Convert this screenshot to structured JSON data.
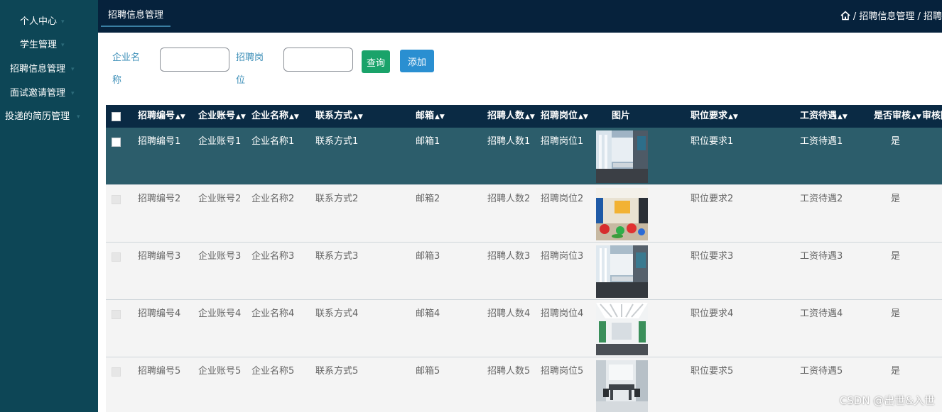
{
  "sidebar": {
    "items": [
      {
        "label": "个人中心"
      },
      {
        "label": "学生管理"
      },
      {
        "label": "招聘信息管理"
      },
      {
        "label": "面试邀请管理"
      },
      {
        "label": "投递的简历管理"
      }
    ]
  },
  "topbar": {
    "tab_label": "招聘信息管理",
    "breadcrumb": "/ 招聘信息管理 / 招聘"
  },
  "search": {
    "company_label": "企业名称",
    "company_value": "",
    "position_label": "招聘岗位",
    "position_value": "",
    "query_label": "查询",
    "add_label": "添加"
  },
  "table": {
    "columns": [
      "招聘编号",
      "企业账号",
      "企业名称",
      "联系方式",
      "邮箱",
      "招聘人数",
      "招聘岗位",
      "图片",
      "职位要求",
      "工资待遇",
      "是否审核",
      "审核回"
    ],
    "rows": [
      {
        "no": "招聘编号1",
        "account": "企业账号1",
        "name": "企业名称1",
        "contact": "联系方式1",
        "email": "邮箱1",
        "count": "招聘人数1",
        "position": "招聘岗位1",
        "image": "office-photo",
        "requirement": "职位要求1",
        "salary": "工资待遇1",
        "audited": "是"
      },
      {
        "no": "招聘编号2",
        "account": "企业账号2",
        "name": "企业名称2",
        "contact": "联系方式2",
        "email": "邮箱2",
        "count": "招聘人数2",
        "position": "招聘岗位2",
        "image": "office-photo",
        "requirement": "职位要求2",
        "salary": "工资待遇2",
        "audited": "是"
      },
      {
        "no": "招聘编号3",
        "account": "企业账号3",
        "name": "企业名称3",
        "contact": "联系方式3",
        "email": "邮箱3",
        "count": "招聘人数3",
        "position": "招聘岗位3",
        "image": "office-photo",
        "requirement": "职位要求3",
        "salary": "工资待遇3",
        "audited": "是"
      },
      {
        "no": "招聘编号4",
        "account": "企业账号4",
        "name": "企业名称4",
        "contact": "联系方式4",
        "email": "邮箱4",
        "count": "招聘人数4",
        "position": "招聘岗位4",
        "image": "office-photo",
        "requirement": "职位要求4",
        "salary": "工资待遇4",
        "audited": "是"
      },
      {
        "no": "招聘编号5",
        "account": "企业账号5",
        "name": "企业名称5",
        "contact": "联系方式5",
        "email": "邮箱5",
        "count": "招聘人数5",
        "position": "招聘岗位5",
        "image": "office-photo",
        "requirement": "职位要求5",
        "salary": "工资待遇5",
        "audited": "是"
      }
    ]
  },
  "watermark": "CSDN @出世&入世",
  "colors": {
    "sidebar": "#0d4656",
    "topbar": "#06223c",
    "table_header": "#0a2a44",
    "selected_row": "#2c5d6b",
    "query_button": "#1aa36a",
    "add_button": "#2a8fd1",
    "search_label": "#3d8fb8"
  }
}
